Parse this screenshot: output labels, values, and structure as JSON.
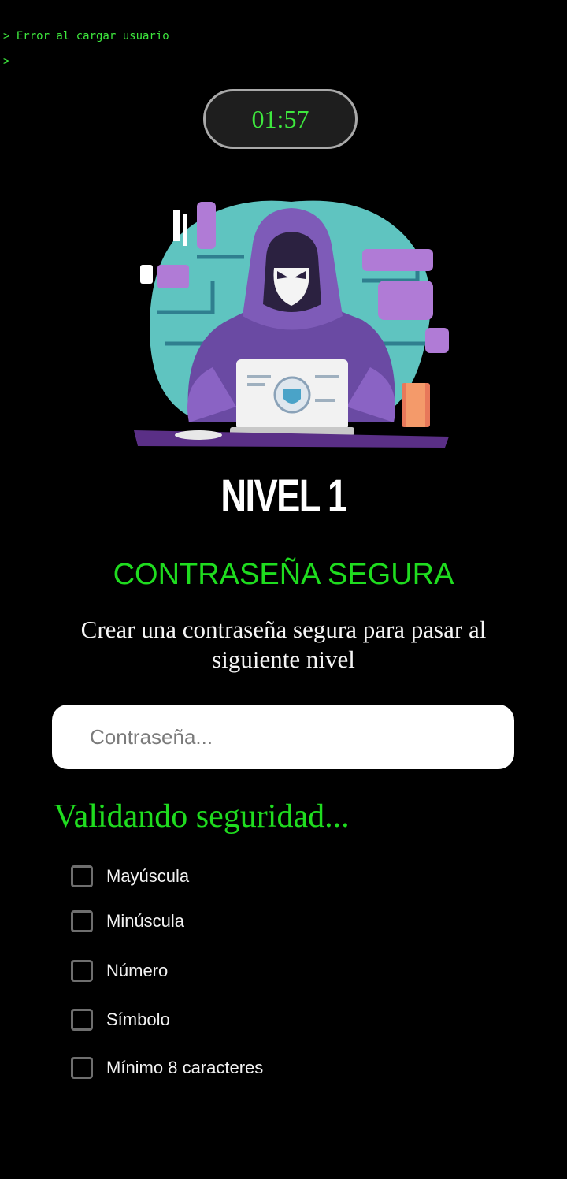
{
  "console": {
    "line1": "> Error al cargar usuario",
    "line2": ">"
  },
  "timer": {
    "value": "01:57"
  },
  "level": {
    "title": "NIVEL 1",
    "challenge": "CONTRASEÑA SEGURA",
    "description": "Crear una contraseña segura para pasar al siguiente nivel"
  },
  "password": {
    "value": "",
    "placeholder": "Contraseña..."
  },
  "validation": {
    "title": "Validando seguridad...",
    "requirements": [
      {
        "label": "Mayúscula",
        "checked": false
      },
      {
        "label": "Minúscula",
        "checked": false
      },
      {
        "label": "Número",
        "checked": false
      },
      {
        "label": "Símbolo",
        "checked": false
      },
      {
        "label": "Mínimo 8 caracteres",
        "checked": false
      }
    ]
  },
  "colors": {
    "accent_green": "#1fdc1f",
    "console_green": "#3ee83e",
    "background": "#000000"
  },
  "icons": {
    "hero": "hacker-illustration"
  }
}
